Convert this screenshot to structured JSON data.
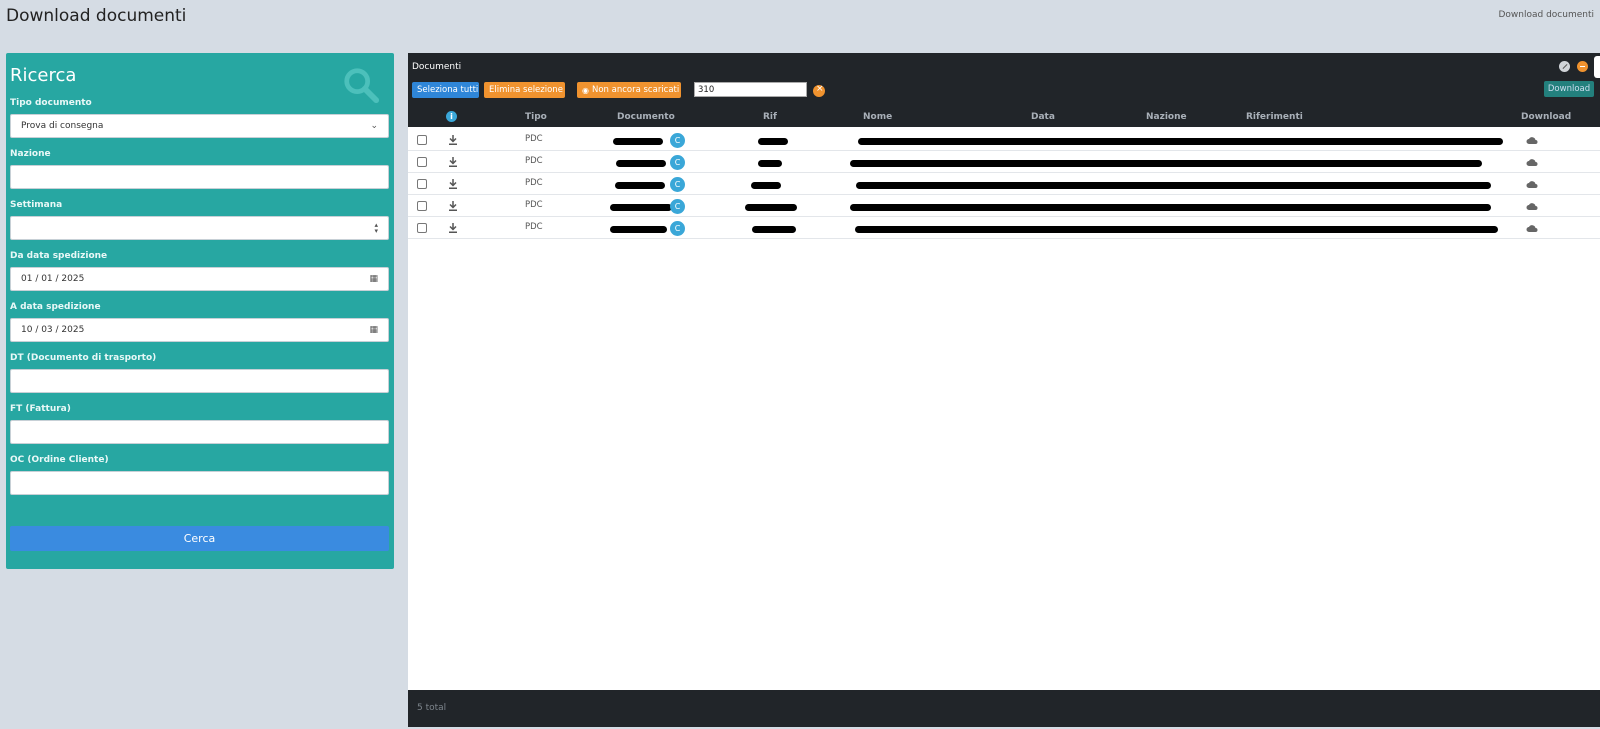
{
  "page": {
    "title": "Download documenti",
    "breadcrumb": "Download documenti"
  },
  "search": {
    "title": "Ricerca",
    "fields": {
      "tipo_documento": {
        "label": "Tipo documento",
        "value": "Prova di consegna"
      },
      "nazione": {
        "label": "Nazione",
        "value": ""
      },
      "settimana": {
        "label": "Settimana",
        "value": ""
      },
      "da_data": {
        "label": "Da data spedizione",
        "value": "01 / 01 / 2025"
      },
      "a_data": {
        "label": "A data spedizione",
        "value": "10 / 03 / 2025"
      },
      "dt": {
        "label": "DT (Documento di trasporto)",
        "value": ""
      },
      "ft": {
        "label": "FT (Fattura)",
        "value": ""
      },
      "oc": {
        "label": "OC (Ordine Cliente)",
        "value": ""
      }
    },
    "button_label": "Cerca"
  },
  "documents": {
    "title": "Documenti",
    "toolbar": {
      "select_all": "Seleziona tutti",
      "delete_selection": "Elimina selezione",
      "not_downloaded": "Non ancora scaricati",
      "filter_value": "310",
      "download": "Download"
    },
    "columns": [
      "Tipo",
      "Documento",
      "Rif",
      "Nome",
      "Data",
      "Nazione",
      "Riferimenti",
      "Download"
    ],
    "rows": [
      {
        "tipo": "PDC",
        "badge": "C"
      },
      {
        "tipo": "PDC",
        "badge": "C"
      },
      {
        "tipo": "PDC",
        "badge": "C"
      },
      {
        "tipo": "PDC",
        "badge": "C"
      },
      {
        "tipo": "PDC",
        "badge": "C"
      }
    ],
    "footer_total": "5 total"
  }
}
